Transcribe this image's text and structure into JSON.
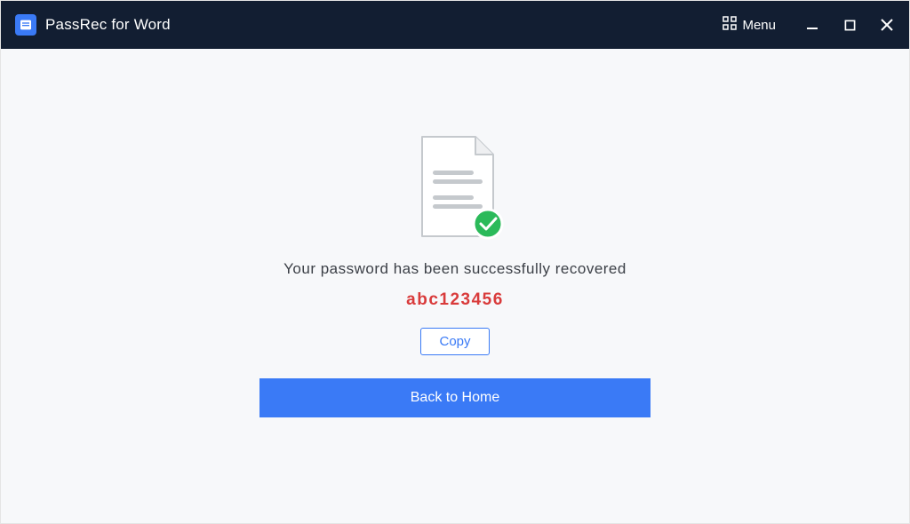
{
  "titlebar": {
    "app_name": "PassRec for Word",
    "menu_label": "Menu"
  },
  "content": {
    "success_message": "Your password has been successfully recovered",
    "recovered_password": "abc123456",
    "copy_label": "Copy",
    "home_label": "Back to Home"
  }
}
